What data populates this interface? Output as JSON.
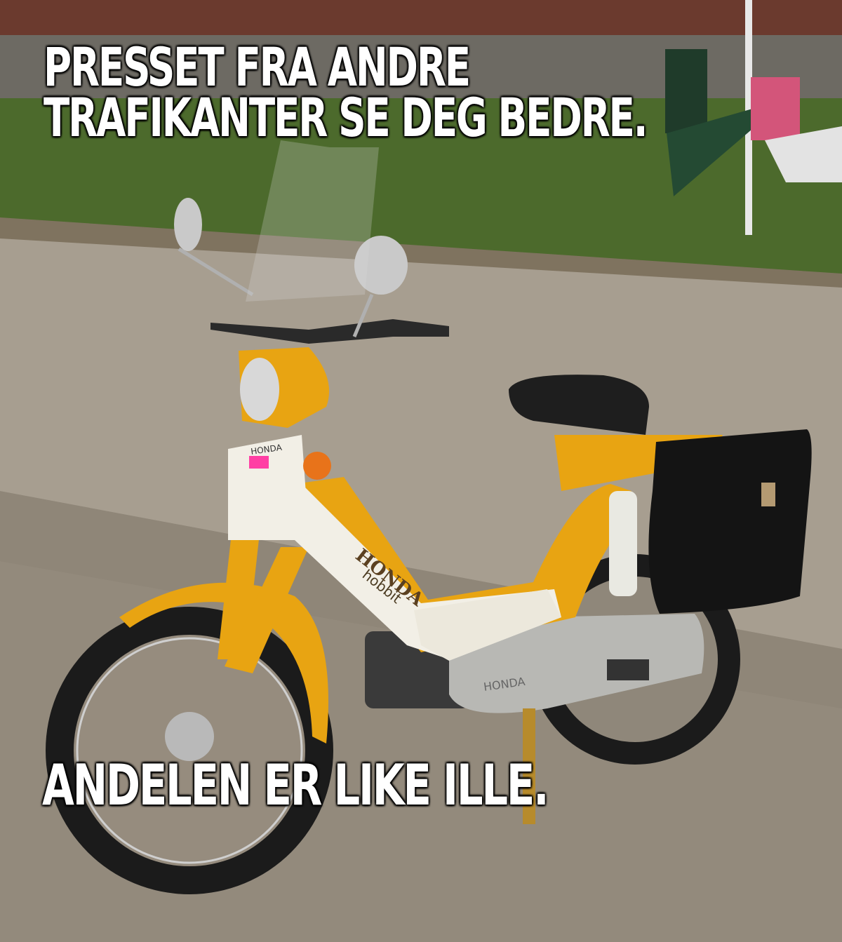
{
  "meme": {
    "top_line_1": "PRESSET FRA ANDRE",
    "top_line_2": "TRAFIKANTER SE DEG BEDRE.",
    "bottom": "ANDELEN ER LIKE ILLE."
  },
  "scene": {
    "subject": "yellow moped",
    "side_panel_text": "HONDA",
    "model_text": "hobbit",
    "front_badge_text": "HONDA",
    "engine_cover_text": "HONDA"
  },
  "colors": {
    "moped_yellow": "#e8a412",
    "panel_white": "#f2efe6",
    "pavement": "#9b9182",
    "grass": "#4c6a2c",
    "brick": "#6b3a2e"
  }
}
